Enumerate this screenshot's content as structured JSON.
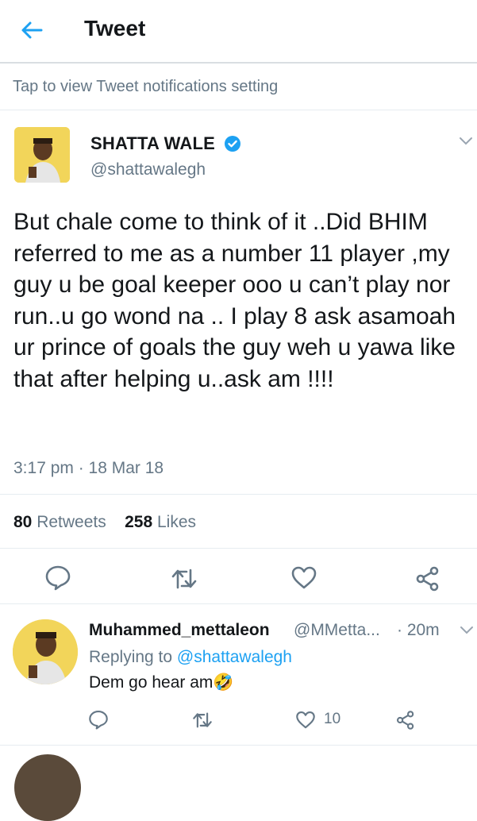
{
  "header": {
    "title": "Tweet",
    "back_icon": "arrow-left-icon"
  },
  "notification_bar": {
    "text": "Tap to view Tweet notifications setting"
  },
  "tweet": {
    "author_name": "SHATTA WALE",
    "author_handle": "@shattawalegh",
    "verified": true,
    "text": "But chale come to think of it ..Did BHIM referred to me as a number 11 player ,my guy u be goal keeper ooo u can’t play nor run..u go wond na .. I play 8 ask asamoah ur prince of goals the guy weh u yawa like that after helping u..ask am !!!!",
    "timestamp": "3:17 pm · 18 Mar 18",
    "retweets_count": "80",
    "retweets_label": "Retweets",
    "likes_count": "258",
    "likes_label": "Likes"
  },
  "reply": {
    "author_name": "Muhammed_mettaleon",
    "author_handle": "@MMetta...",
    "time": "· 20m",
    "replying_prefix": "Replying to ",
    "replying_to": "@shattawalegh",
    "text": "Dem go hear am",
    "emoji": "🤣",
    "like_count": "10"
  },
  "colors": {
    "accent": "#1da1f2",
    "muted": "#657786",
    "text": "#14171a",
    "divider": "#e6ecf0"
  }
}
